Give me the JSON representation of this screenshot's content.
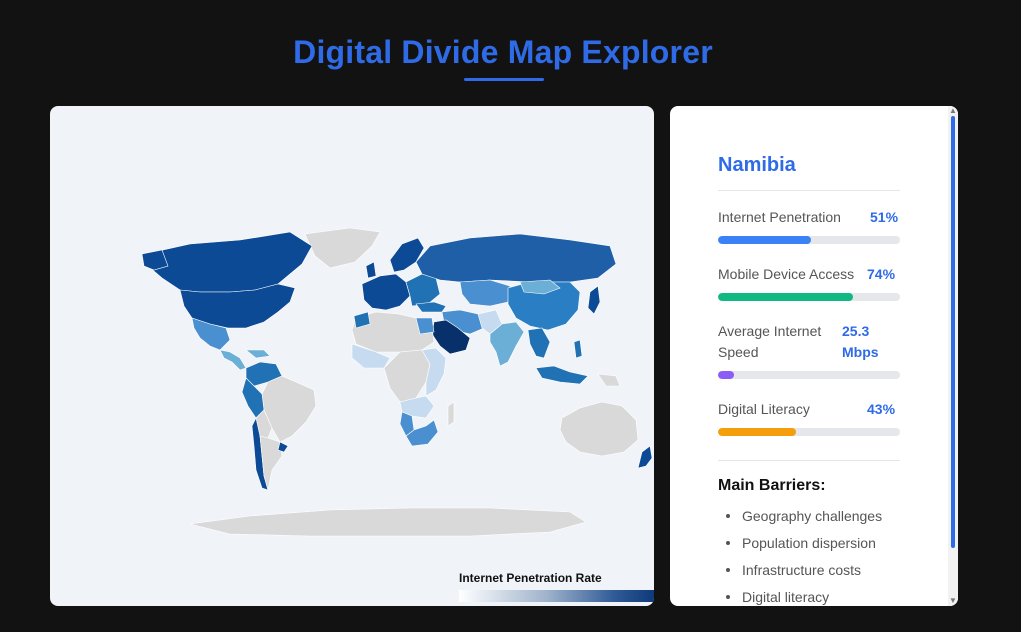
{
  "page": {
    "title": "Digital Divide Map Explorer"
  },
  "map": {
    "legend_title": "Internet Penetration Rate",
    "colors": {
      "dark": "#08306b",
      "mid": "#2171b5",
      "light": "#6baed6",
      "pale": "#c6dbef",
      "nodata": "#d9d9d9",
      "ocean": "#f0f4f9"
    }
  },
  "details": {
    "country": "Namibia",
    "metrics": [
      {
        "label": "Internet Penetration",
        "value": "51%",
        "level": 0.51,
        "color": "#3b82f6"
      },
      {
        "label": "Mobile Device Access",
        "value": "74%",
        "level": 0.74,
        "color": "#10b981"
      },
      {
        "label": "Average Internet Speed",
        "value": "25.3 Mbps",
        "level": 0.09,
        "color": "#8b5cf6"
      },
      {
        "label": "Digital Literacy",
        "value": "43%",
        "level": 0.43,
        "color": "#f59e0b"
      }
    ],
    "barriers_title": "Main Barriers:",
    "barriers": [
      "Geography challenges",
      "Population dispersion",
      "Infrastructure costs",
      "Digital literacy"
    ]
  }
}
